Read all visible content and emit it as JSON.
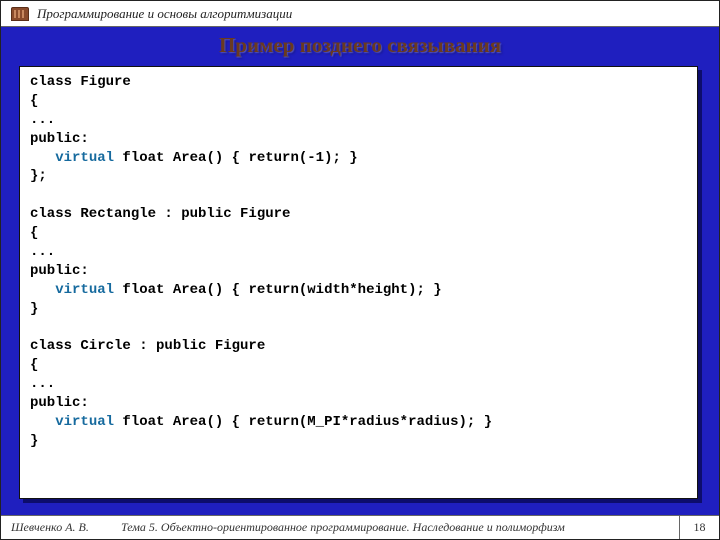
{
  "header": {
    "course_title": "Программирование и основы алгоритмизации"
  },
  "slide": {
    "title": "Пример позднего связывания"
  },
  "code": {
    "keyword": "virtual",
    "lines_before_1": "class Figure\n{\n...\npublic:\n   ",
    "lines_after_1": " float Area() { return(-1); }\n};\n\nclass Rectangle : public Figure\n{\n...\npublic:\n   ",
    "lines_after_2": " float Area() { return(width*height); }\n}\n\nclass Circle : public Figure\n{\n...\npublic:\n   ",
    "lines_after_3": " float Area() { return(M_PI*radius*radius); }\n}"
  },
  "footer": {
    "author": "Шевченко А. В.",
    "topic": "Тема 5. Объектно-ориентированное программирование. Наследование и полиморфизм",
    "page": "18"
  }
}
